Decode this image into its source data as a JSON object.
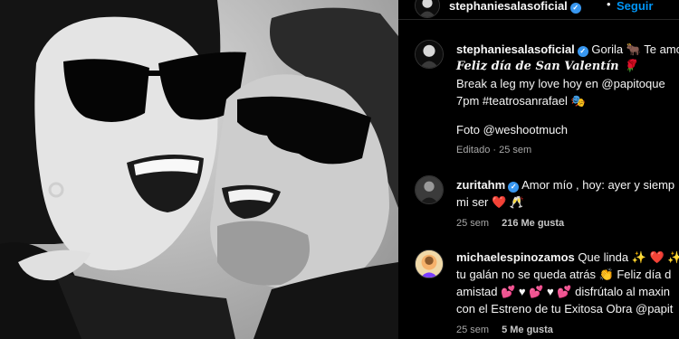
{
  "header": {
    "username": "stephaniesalasoficial",
    "verified_icon": "✓",
    "separator": "•",
    "follow_label": "Seguir"
  },
  "caption": {
    "username": "stephaniesalasoficial",
    "line1": "Gorila 🐂 Te amo",
    "line2": "Feliz día de San Valentín 🌹",
    "line3": "Break a leg my love hoy en @papitoque",
    "line4": "7pm #teatrosanrafael 🎭",
    "line5": "Foto @weshootmuch",
    "meta": "Editado · 25 sem"
  },
  "comments": [
    {
      "username": "zuritahm",
      "line1": "Amor mío , hoy: ayer y siemp",
      "line2_text": "mi ser",
      "line2_icons": "❤️ 🥂",
      "time": "25 sem",
      "likes": "216 Me gusta"
    },
    {
      "username": "michaelespinozamos",
      "line1": "Que linda ✨ ❤️ ✨",
      "line2": "tu galán no se queda atrás 👏 Feliz día d",
      "line3": "amistad 💕 ♥ 💕 ♥ 💕 disfrútalo al maxin",
      "line4": "con el Estreno de tu Exitosa Obra @papit",
      "time": "25 sem",
      "likes": "5 Me gusta"
    }
  ],
  "colors": {
    "link": "#0095f6",
    "verified": "#3897f0",
    "muted_text": "#a8a8a8",
    "background": "#000000"
  }
}
